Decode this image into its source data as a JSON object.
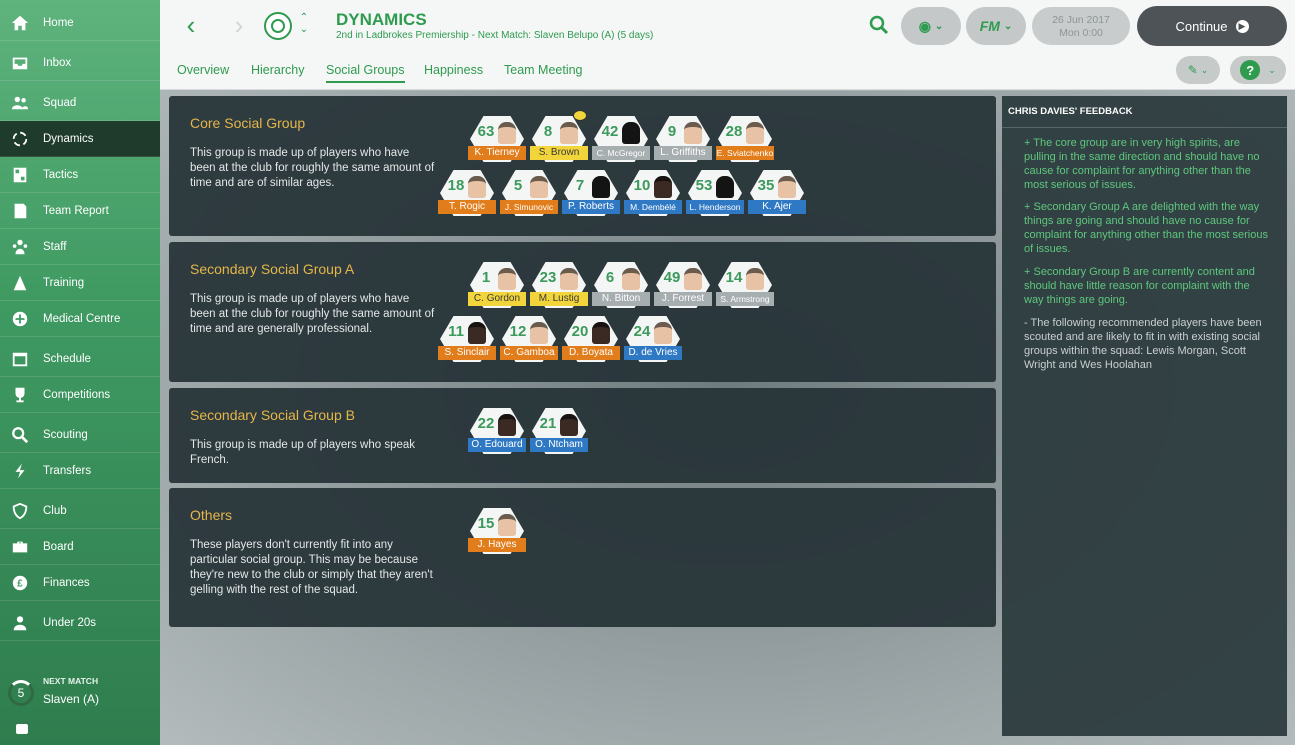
{
  "sidebar": {
    "items": [
      {
        "label": "Home",
        "icon": "home-icon"
      },
      {
        "label": "Inbox",
        "icon": "inbox-icon"
      },
      {
        "label": "Squad",
        "icon": "squad-icon"
      },
      {
        "label": "Dynamics",
        "icon": "dynamics-icon"
      },
      {
        "label": "Tactics",
        "icon": "tactics-icon"
      },
      {
        "label": "Team Report",
        "icon": "report-icon"
      },
      {
        "label": "Staff",
        "icon": "staff-icon"
      },
      {
        "label": "Training",
        "icon": "training-icon"
      },
      {
        "label": "Medical Centre",
        "icon": "medical-icon"
      },
      {
        "label": "Schedule",
        "icon": "calendar-icon"
      },
      {
        "label": "Competitions",
        "icon": "trophy-icon"
      },
      {
        "label": "Scouting",
        "icon": "search-icon"
      },
      {
        "label": "Transfers",
        "icon": "transfers-icon"
      },
      {
        "label": "Club",
        "icon": "shield-icon"
      },
      {
        "label": "Board",
        "icon": "briefcase-icon"
      },
      {
        "label": "Finances",
        "icon": "pound-icon"
      },
      {
        "label": "Under 20s",
        "icon": "u20-icon"
      }
    ],
    "next_match": {
      "title": "NEXT MATCH",
      "value": "Slaven (A)",
      "days": "5"
    }
  },
  "header": {
    "title": "DYNAMICS",
    "subtitle": "2nd in Ladbrokes Premiership - Next Match: Slaven Belupo (A) (5 days)",
    "date": "26 Jun 2017",
    "time": "Mon 0:00",
    "continue_label": "Continue",
    "fm_label": "FM"
  },
  "tabs": [
    "Overview",
    "Hierarchy",
    "Social Groups",
    "Happiness",
    "Team Meeting"
  ],
  "active_tab": "Social Groups",
  "groups": [
    {
      "title": "Core Social Group",
      "desc": "This group is made up of players who have been at the club for roughly the same amount of time and are of similar ages.",
      "players": [
        {
          "num": "63",
          "name": "K. Tierney",
          "color": "orange"
        },
        {
          "num": "8",
          "name": "S. Brown",
          "color": "yellow"
        },
        {
          "num": "42",
          "name": "C. McGregor",
          "color": "grey"
        },
        {
          "num": "9",
          "name": "L. Griffiths",
          "color": "grey"
        },
        {
          "num": "28",
          "name": "E. Sviatchenko",
          "color": "orange"
        },
        {
          "num": "18",
          "name": "T. Rogic",
          "color": "orange"
        },
        {
          "num": "5",
          "name": "J. Simunovic",
          "color": "orange"
        },
        {
          "num": "7",
          "name": "P. Roberts",
          "color": "blue"
        },
        {
          "num": "10",
          "name": "M. Dembélé",
          "color": "blue"
        },
        {
          "num": "53",
          "name": "L. Henderson",
          "color": "blue"
        },
        {
          "num": "35",
          "name": "K. Ajer",
          "color": "blue"
        }
      ]
    },
    {
      "title": "Secondary Social Group A",
      "desc": "This group is made up of players who have been at the club for roughly the same amount of time and are generally professional.",
      "players": [
        {
          "num": "1",
          "name": "C. Gordon",
          "color": "yellow"
        },
        {
          "num": "23",
          "name": "M. Lustig",
          "color": "yellow"
        },
        {
          "num": "6",
          "name": "N. Bitton",
          "color": "grey"
        },
        {
          "num": "49",
          "name": "J. Forrest",
          "color": "grey"
        },
        {
          "num": "14",
          "name": "S. Armstrong",
          "color": "grey"
        },
        {
          "num": "11",
          "name": "S. Sinclair",
          "color": "orange"
        },
        {
          "num": "12",
          "name": "C. Gamboa",
          "color": "orange"
        },
        {
          "num": "20",
          "name": "D. Boyata",
          "color": "orange"
        },
        {
          "num": "24",
          "name": "D. de Vries",
          "color": "blue"
        }
      ]
    },
    {
      "title": "Secondary Social Group B",
      "desc": "This group is made up of players who speak French.",
      "players": [
        {
          "num": "22",
          "name": "O. Edouard",
          "color": "blue"
        },
        {
          "num": "21",
          "name": "O. Ntcham",
          "color": "blue"
        }
      ]
    },
    {
      "title": "Others",
      "desc": "These players don't currently fit into any particular social group. This may be because they're new to the club or simply that they aren't gelling with the rest of the squad.",
      "players": [
        {
          "num": "15",
          "name": "J. Hayes",
          "color": "orange"
        }
      ]
    }
  ],
  "feedback": {
    "title": "CHRIS DAVIES' FEEDBACK",
    "items": [
      {
        "text": "+   The core group are in very high spirits, are pulling in the same direction and should have no cause for complaint for anything other than the most serious of issues.",
        "tone": "pos"
      },
      {
        "text": "+   Secondary Group A are delighted with the way things are going and should have no cause for complaint for anything other than the most serious of issues.",
        "tone": "pos"
      },
      {
        "text": "+   Secondary Group B are currently content and should have little reason for complaint with the way things are going.",
        "tone": "pos"
      },
      {
        "text": "-   The following recommended players have been scouted and are likely to fit in with existing social groups within the squad: Lewis Morgan, Scott Wright and Wes Hoolahan",
        "tone": "neutral"
      }
    ]
  }
}
